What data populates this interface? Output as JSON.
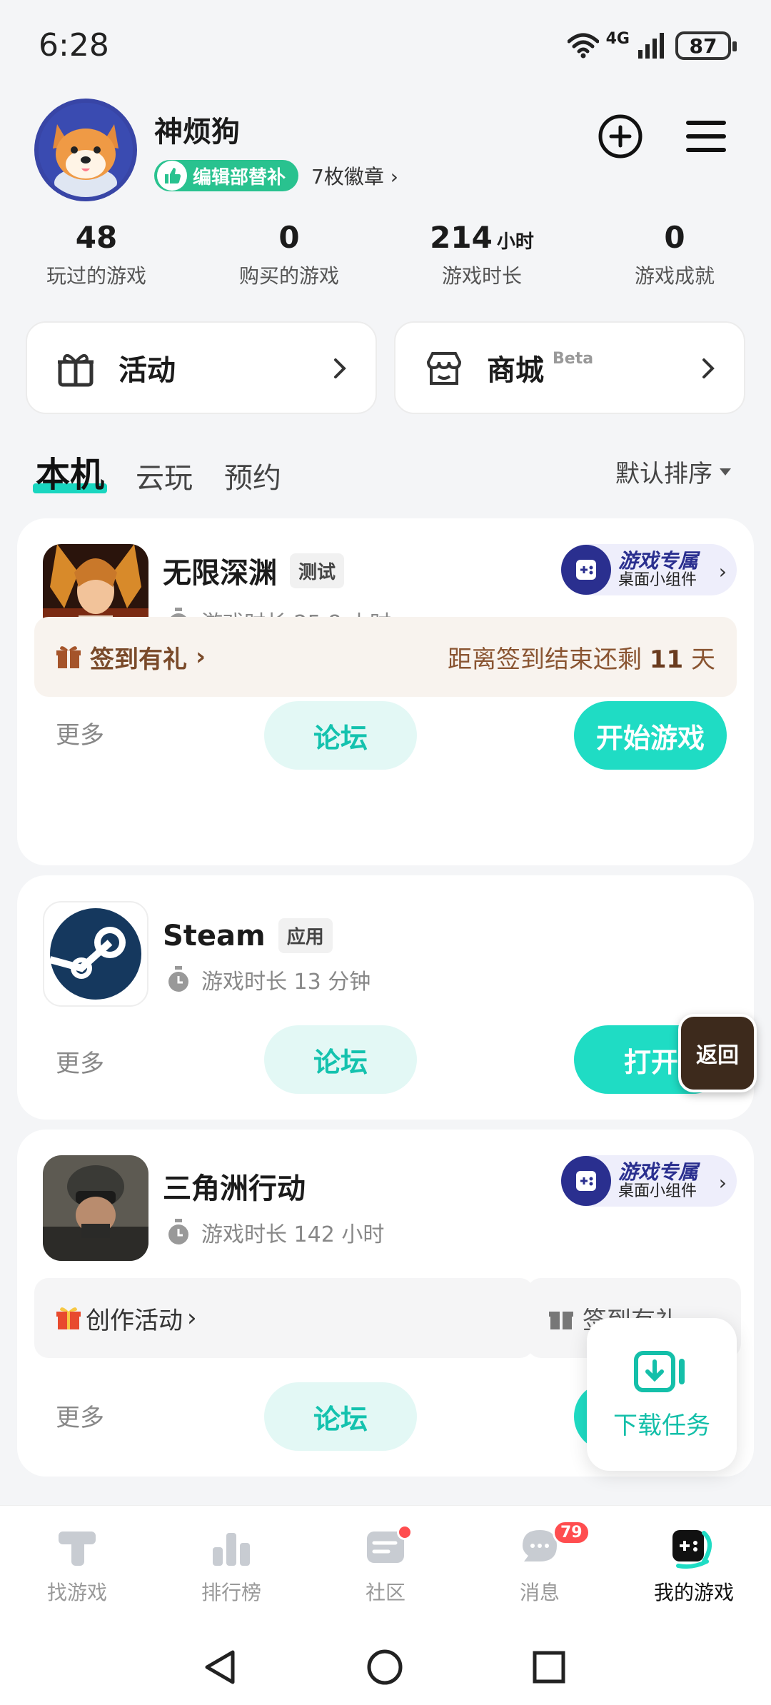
{
  "status_bar": {
    "time": "6:28",
    "network": "4G",
    "battery": "87"
  },
  "profile": {
    "username": "神烦狗",
    "role_badge": "编辑部替补",
    "medal_count": "7枚徽章"
  },
  "stats": [
    {
      "value": "48",
      "unit": "",
      "label": "玩过的游戏"
    },
    {
      "value": "0",
      "unit": "",
      "label": "购买的游戏"
    },
    {
      "value": "214",
      "unit": "小时",
      "label": "游戏时长"
    },
    {
      "value": "0",
      "unit": "",
      "label": "游戏成就"
    }
  ],
  "quick": {
    "activity": "活动",
    "mall": "商城",
    "mall_badge": "Beta"
  },
  "tabs": {
    "local": "本机",
    "cloud": "云玩",
    "reserve": "预约",
    "sort": "默认排序"
  },
  "games": [
    {
      "name": "无限深渊",
      "tag": "测试",
      "playtime": "游戏时长 25.8 小时",
      "widget_t1": "游戏专属",
      "widget_t2": "桌面小组件",
      "checkin_label": "签到有礼",
      "checkin_prefix": "距离签到结束还剩",
      "checkin_days": "11",
      "checkin_suffix": "天",
      "more": "更多",
      "forum": "论坛",
      "action": "开始游戏"
    },
    {
      "name": "Steam",
      "tag": "应用",
      "playtime": "游戏时长 13 分钟",
      "more": "更多",
      "forum": "论坛",
      "action": "打开"
    },
    {
      "name": "三角洲行动",
      "playtime": "游戏时长 142 小时",
      "widget_t1": "游戏专属",
      "widget_t2": "桌面小组件",
      "activity": "创作活动",
      "checkin_label": "签到有礼",
      "more": "更多",
      "forum": "论坛"
    }
  ],
  "floating": {
    "back": "返回",
    "download": "下载任务"
  },
  "bottom_nav": [
    {
      "label": "找游戏"
    },
    {
      "label": "排行榜"
    },
    {
      "label": "社区"
    },
    {
      "label": "消息",
      "badge": "79"
    },
    {
      "label": "我的游戏"
    }
  ],
  "colors": {
    "accent": "#1fdcc4",
    "role_badge": "#29c28f",
    "notify": "#ff4d4f",
    "widget": "#2a2f8f"
  }
}
